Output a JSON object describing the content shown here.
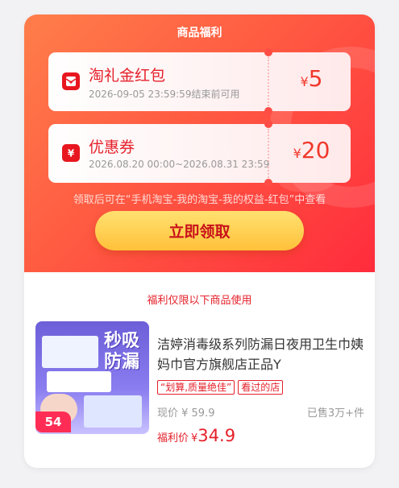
{
  "header": {
    "title": "商品福利"
  },
  "coupons": [
    {
      "name": "淘礼金红包",
      "subtitle": "2026-09-05 23:59:59结束前可用",
      "currency": "¥",
      "amount": "5",
      "icon": "red-envelope-icon"
    },
    {
      "name": "优惠券",
      "subtitle": "2026.08.20 00:00~2026.08.31 23:59",
      "currency": "¥",
      "amount": "20",
      "icon": "coupon-yen-icon"
    }
  ],
  "hint": "领取后可在“手机淘宝-我的淘宝-我的权益-红包”中查看",
  "claim_button": "立即领取",
  "limit_text": "福利仅限以下商品使用",
  "product": {
    "title": "洁婷消毒级系列防漏日夜用卫生巾姨妈巾官方旗舰店正品Y",
    "tags": [
      "“划算,质量绝佳”",
      "看过的店"
    ],
    "original_price": "现价 ¥ 59.9",
    "sold": "已售3万+件",
    "deal_label": "福利价",
    "deal_currency": "¥",
    "deal_price": "34.9",
    "thumb_slogan": "秒吸防漏",
    "thumb_price": "54"
  },
  "colors": {
    "accent_red": "#e5202a",
    "hero_start": "#ff7e4a",
    "hero_end": "#ff2c3c",
    "button_yellow": "#ffc13a"
  }
}
